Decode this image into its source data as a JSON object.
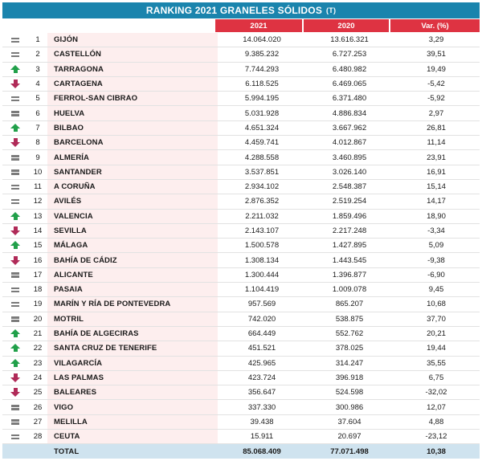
{
  "title": "RANKING 2021 GRANELES SÓLIDOS",
  "unit": "(T)",
  "columns": {
    "y2021": "2021",
    "y2020": "2020",
    "var": "Var. (%)"
  },
  "rows": [
    {
      "trend": "equal",
      "rank": "1",
      "port": "GIJÓN",
      "v2021": "14.064.020",
      "v2020": "13.616.321",
      "var": "3,29"
    },
    {
      "trend": "equal",
      "rank": "2",
      "port": "CASTELLÓN",
      "v2021": "9.385.232",
      "v2020": "6.727.253",
      "var": "39,51"
    },
    {
      "trend": "up",
      "rank": "3",
      "port": "TARRAGONA",
      "v2021": "7.744.293",
      "v2020": "6.480.982",
      "var": "19,49"
    },
    {
      "trend": "down",
      "rank": "4",
      "port": "CARTAGENA",
      "v2021": "6.118.525",
      "v2020": "6.469.065",
      "var": "-5,42"
    },
    {
      "trend": "equal",
      "rank": "5",
      "port": "FERROL-SAN CIBRAO",
      "v2021": "5.994.195",
      "v2020": "6.371.480",
      "var": "-5,92"
    },
    {
      "trend": "equal",
      "rank": "6",
      "port": "HUELVA",
      "v2021": "5.031.928",
      "v2020": "4.886.834",
      "var": "2,97"
    },
    {
      "trend": "up",
      "rank": "7",
      "port": "BILBAO",
      "v2021": "4.651.324",
      "v2020": "3.667.962",
      "var": "26,81"
    },
    {
      "trend": "down",
      "rank": "8",
      "port": "BARCELONA",
      "v2021": "4.459.741",
      "v2020": "4.012.867",
      "var": "11,14"
    },
    {
      "trend": "equal",
      "rank": "9",
      "port": "ALMERÍA",
      "v2021": "4.288.558",
      "v2020": "3.460.895",
      "var": "23,91"
    },
    {
      "trend": "equal",
      "rank": "10",
      "port": "SANTANDER",
      "v2021": "3.537.851",
      "v2020": "3.026.140",
      "var": "16,91"
    },
    {
      "trend": "equal",
      "rank": "11",
      "port": "A CORUÑA",
      "v2021": "2.934.102",
      "v2020": "2.548.387",
      "var": "15,14"
    },
    {
      "trend": "equal",
      "rank": "12",
      "port": "AVILÉS",
      "v2021": "2.876.352",
      "v2020": "2.519.254",
      "var": "14,17"
    },
    {
      "trend": "up",
      "rank": "13",
      "port": "VALENCIA",
      "v2021": "2.211.032",
      "v2020": "1.859.496",
      "var": "18,90"
    },
    {
      "trend": "down",
      "rank": "14",
      "port": "SEVILLA",
      "v2021": "2.143.107",
      "v2020": "2.217.248",
      "var": "-3,34"
    },
    {
      "trend": "up",
      "rank": "15",
      "port": "MÁLAGA",
      "v2021": "1.500.578",
      "v2020": "1.427.895",
      "var": "5,09"
    },
    {
      "trend": "down",
      "rank": "16",
      "port": "BAHÍA DE CÁDIZ",
      "v2021": "1.308.134",
      "v2020": "1.443.545",
      "var": "-9,38"
    },
    {
      "trend": "equal",
      "rank": "17",
      "port": "ALICANTE",
      "v2021": "1.300.444",
      "v2020": "1.396.877",
      "var": "-6,90"
    },
    {
      "trend": "equal",
      "rank": "18",
      "port": "PASAIA",
      "v2021": "1.104.419",
      "v2020": "1.009.078",
      "var": "9,45"
    },
    {
      "trend": "equal",
      "rank": "19",
      "port": "MARÍN Y RÍA DE PONTEVEDRA",
      "v2021": "957.569",
      "v2020": "865.207",
      "var": "10,68"
    },
    {
      "trend": "equal",
      "rank": "20",
      "port": "MOTRIL",
      "v2021": "742.020",
      "v2020": "538.875",
      "var": "37,70"
    },
    {
      "trend": "up",
      "rank": "21",
      "port": "BAHÍA DE ALGECIRAS",
      "v2021": "664.449",
      "v2020": "552.762",
      "var": "20,21"
    },
    {
      "trend": "up",
      "rank": "22",
      "port": "SANTA CRUZ DE TENERIFE",
      "v2021": "451.521",
      "v2020": "378.025",
      "var": "19,44"
    },
    {
      "trend": "up",
      "rank": "23",
      "port": "VILAGARCÍA",
      "v2021": "425.965",
      "v2020": "314.247",
      "var": "35,55"
    },
    {
      "trend": "down",
      "rank": "24",
      "port": "LAS PALMAS",
      "v2021": "423.724",
      "v2020": "396.918",
      "var": "6,75"
    },
    {
      "trend": "down",
      "rank": "25",
      "port": "BALEARES",
      "v2021": "356.647",
      "v2020": "524.598",
      "var": "-32,02"
    },
    {
      "trend": "equal",
      "rank": "26",
      "port": "VIGO",
      "v2021": "337.330",
      "v2020": "300.986",
      "var": "12,07"
    },
    {
      "trend": "equal",
      "rank": "27",
      "port": "MELILLA",
      "v2021": "39.438",
      "v2020": "37.604",
      "var": "4,88"
    },
    {
      "trend": "equal",
      "rank": "28",
      "port": "CEUTA",
      "v2021": "15.911",
      "v2020": "20.697",
      "var": "-23,12"
    }
  ],
  "total": {
    "label": "TOTAL",
    "v2021": "85.068.409",
    "v2020": "77.071.498",
    "var": "10,38"
  },
  "colors": {
    "title_bg": "#1a84ad",
    "header_bg": "#de3342",
    "name_bg": "#fdeeee",
    "total_bg": "#cfe3ef",
    "up": "#21a04a",
    "down": "#b02a58",
    "equal": "#7a7a7a"
  }
}
